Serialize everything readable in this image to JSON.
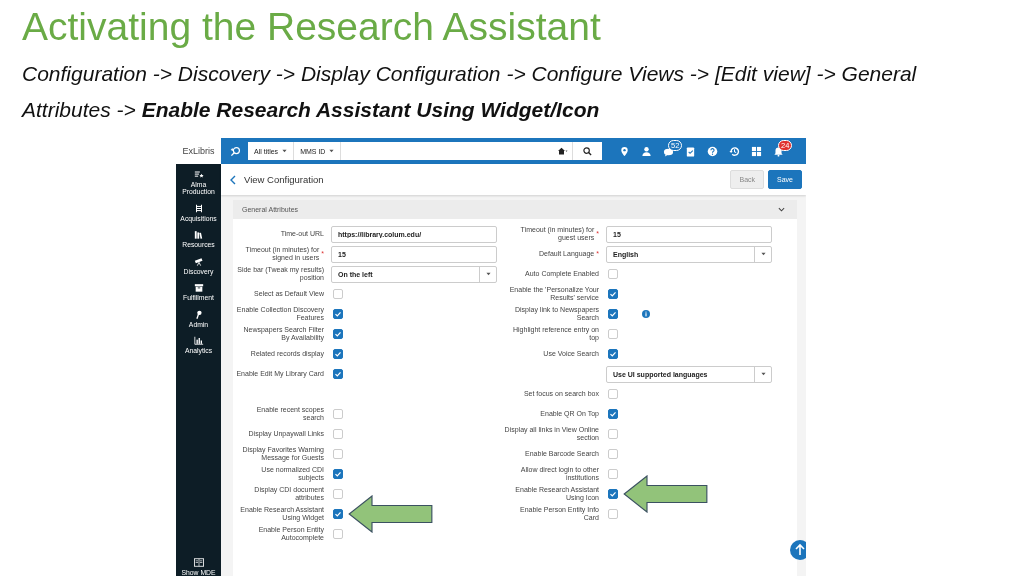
{
  "slide": {
    "title": "Activating the Research Assistant",
    "subtitle": "Configuration -> Discovery -> Display Configuration -> Configure Views -> [Edit view] -> General Attributes -> **Enable Research Assistant Using Widget/Icon**"
  },
  "app": {
    "logo": "ExLibris",
    "search": {
      "scope": "All titles",
      "field": "MMS ID"
    },
    "top_icons": [
      {
        "kind": "pin"
      },
      {
        "kind": "person"
      },
      {
        "kind": "chat",
        "badge": "52",
        "color": "#1c75bc"
      },
      {
        "kind": "clipboard"
      },
      {
        "kind": "help"
      },
      {
        "kind": "history"
      },
      {
        "kind": "grid"
      },
      {
        "kind": "bell",
        "badge": "24",
        "color": "#e0312f"
      }
    ],
    "sidebar": {
      "items": [
        {
          "kind": "production",
          "label": "Alma Production"
        },
        {
          "kind": "acquisitions",
          "label": "Acquisitions"
        },
        {
          "kind": "resources",
          "label": "Resources"
        },
        {
          "kind": "discovery",
          "label": "Discovery"
        },
        {
          "kind": "fulfillment",
          "label": "Fulfillment"
        },
        {
          "kind": "admin",
          "label": "Admin"
        },
        {
          "kind": "analytics",
          "label": "Analytics"
        }
      ],
      "bottom": {
        "label": "Show MDE"
      }
    }
  },
  "page": {
    "title": "View Configuration",
    "buttons": [
      {
        "label": "Back",
        "disabled": true
      },
      {
        "label": "Save",
        "disabled": false
      }
    ]
  },
  "section": {
    "title": "General Attributes",
    "expanded": true
  },
  "rows": [
    {
      "left": {
        "kind": "text",
        "label": "Time-out URL",
        "value": "https://library.colum.edu/"
      },
      "right": {
        "kind": "text",
        "label": "Timeout (in minutes) for guest users",
        "required": "*",
        "value": "15"
      }
    },
    {
      "left": {
        "kind": "text",
        "label": "Timeout (in minutes) for signed in users",
        "required": "*",
        "value": "15"
      },
      "right": {
        "kind": "select",
        "label": "Default Language",
        "required": "*",
        "value": "English"
      }
    },
    {
      "left": {
        "kind": "select",
        "label": "Side bar (Tweak my results) position",
        "value": "On the left"
      },
      "right": {
        "kind": "checkbox",
        "label": "Auto Complete Enabled",
        "checked": false
      }
    },
    {
      "left": {
        "kind": "checkbox",
        "label": "Select as Default View",
        "checked": false
      },
      "right": {
        "kind": "checkbox",
        "label": "Enable the 'Personalize Your Results' service",
        "checked": true
      }
    },
    {
      "left": {
        "kind": "checkbox",
        "label": "Enable Collection Discovery Features",
        "checked": true
      },
      "right": {
        "kind": "checkbox",
        "label": "Display link to Newspapers Search",
        "checked": true,
        "info": true
      }
    },
    {
      "left": {
        "kind": "checkbox",
        "label": "Newspapers Search Filter By Availability",
        "checked": true
      },
      "right": {
        "kind": "checkbox",
        "label": "Highlight reference entry on top",
        "checked": false
      }
    },
    {
      "left": {
        "kind": "checkbox",
        "label": "Related records display",
        "checked": true
      },
      "right": {
        "kind": "checkbox",
        "label": "Use Voice Search",
        "checked": true
      }
    },
    {
      "left": {
        "kind": "checkbox",
        "label": "Enable Edit My Library Card",
        "checked": true
      },
      "right": {
        "kind": "select",
        "value": "Use UI supported languages"
      }
    },
    {
      "right": {
        "kind": "checkbox",
        "label": "Set focus on search box",
        "checked": false
      }
    },
    {
      "left": {
        "kind": "checkbox",
        "label": "Enable recent scopes search",
        "checked": false
      },
      "right": {
        "kind": "checkbox",
        "label": "Enable QR On Top",
        "checked": true
      }
    },
    {
      "left": {
        "kind": "checkbox",
        "label": "Display Unpaywall Links",
        "checked": false
      },
      "right": {
        "kind": "checkbox",
        "label": "Display all links in View Online section",
        "checked": false
      }
    },
    {
      "left": {
        "kind": "checkbox",
        "label": "Display Favorites Warning Message for Guests",
        "checked": false
      },
      "right": {
        "kind": "checkbox",
        "label": "Enable Barcode Search",
        "checked": false
      }
    },
    {
      "left": {
        "kind": "checkbox",
        "label": "Use normalized CDI subjects",
        "checked": true
      },
      "right": {
        "kind": "checkbox",
        "label": "Allow direct login to other institutions",
        "checked": false
      }
    },
    {
      "left": {
        "kind": "checkbox",
        "label": "Display CDI document attributes",
        "checked": false
      },
      "right": {
        "kind": "checkbox",
        "label": "Enable Research Assistant Using Icon",
        "checked": true,
        "arrow": true
      }
    },
    {
      "left": {
        "kind": "checkbox",
        "label": "Enable Research Assistant Using Widget",
        "checked": true,
        "arrow": true
      },
      "right": {
        "kind": "checkbox",
        "label": "Enable Person Entity Info Card",
        "checked": false
      }
    },
    {
      "left": {
        "kind": "checkbox",
        "label": "Enable Person Entity Autocomplete",
        "checked": false
      }
    }
  ]
}
